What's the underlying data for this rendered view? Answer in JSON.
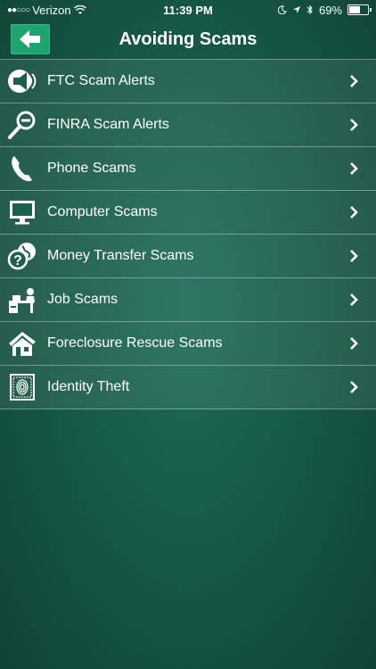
{
  "status_bar": {
    "carrier": "Verizon",
    "time": "11:39 PM",
    "battery": "69%",
    "battery_level": 0.69
  },
  "nav": {
    "title": "Avoiding Scams",
    "back_icon": "back-arrow-icon"
  },
  "items": [
    {
      "label": "FTC Scam Alerts",
      "icon": "megaphone-icon"
    },
    {
      "label": "FINRA Scam Alerts",
      "icon": "magnifier-minus-icon"
    },
    {
      "label": "Phone Scams",
      "icon": "phone-handset-icon"
    },
    {
      "label": "Computer Scams",
      "icon": "computer-monitor-icon"
    },
    {
      "label": "Money Transfer Scams",
      "icon": "question-globe-icon"
    },
    {
      "label": "Job Scams",
      "icon": "office-desk-icon"
    },
    {
      "label": "Foreclosure Rescue Scams",
      "icon": "house-icon"
    },
    {
      "label": "Identity Theft",
      "icon": "fingerprint-icon"
    }
  ],
  "colors": {
    "background": "#175a49",
    "accent": "#1da56e",
    "text": "#ffffff"
  }
}
